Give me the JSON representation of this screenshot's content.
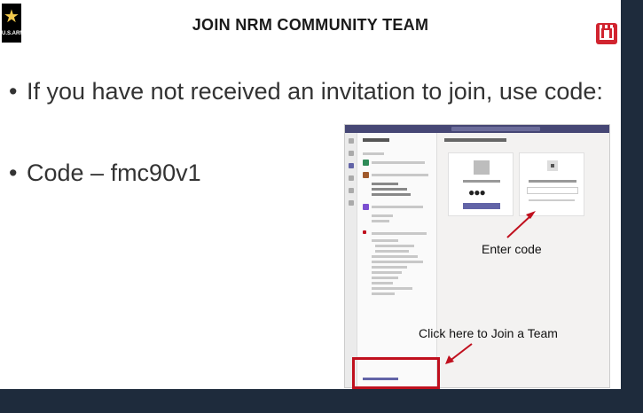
{
  "header": {
    "title": "JOIN NRM COMMUNITY TEAM",
    "left_logo": {
      "text": "U.S.ARMY",
      "icon": "army-star-icon"
    },
    "right_logo": {
      "icon": "usace-castle-icon",
      "color": "#d1242f"
    }
  },
  "bullets": [
    "If you have not received an invitation to join, use code:",
    "Code – fmc90v1"
  ],
  "annotations": {
    "enter_code": "Enter code",
    "join_team": "Click here to Join a Team",
    "highlight_color": "#c0101e"
  }
}
